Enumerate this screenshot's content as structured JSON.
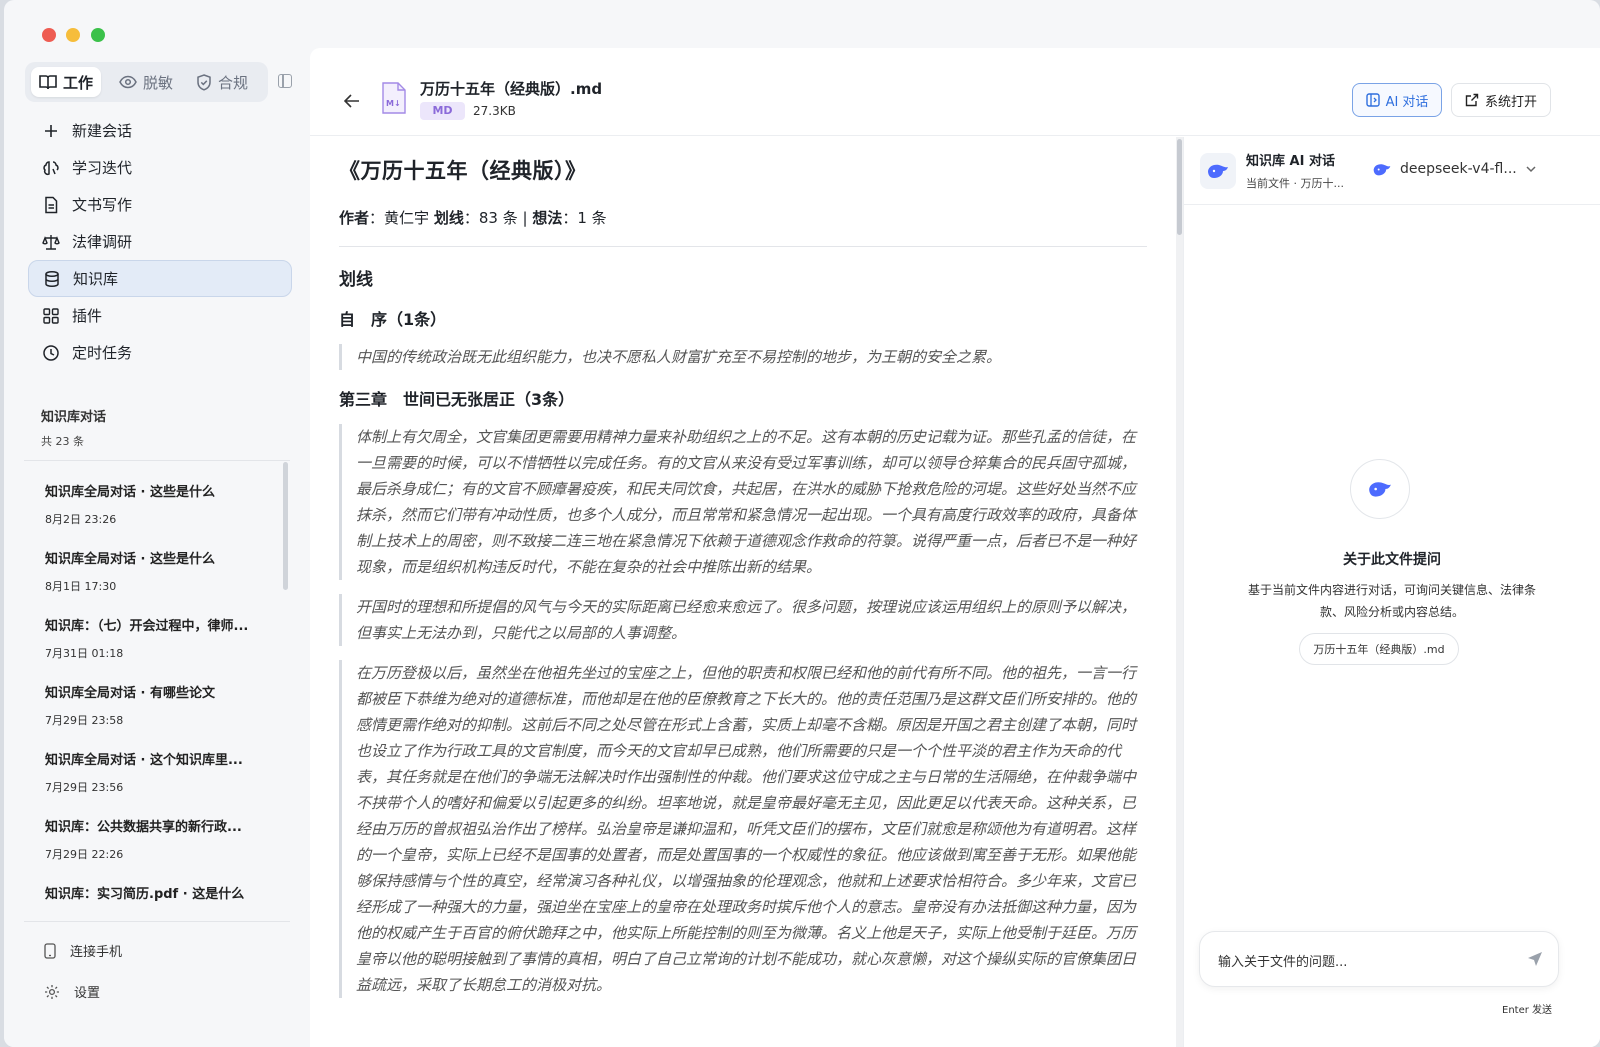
{
  "colors": {
    "accent": "#2f6fde",
    "active_nav": "#e3ebf7",
    "md_badge": "#8b6ad9",
    "close": "#ee5c52",
    "minimize": "#f6bd3b",
    "zoom": "#3bc14a"
  },
  "sidebar": {
    "segments": [
      {
        "label": "工作",
        "icon": "book-icon"
      },
      {
        "label": "脱敏",
        "icon": "eye-icon"
      },
      {
        "label": "合规",
        "icon": "shield-icon"
      }
    ],
    "nav": [
      {
        "label": "新建会话",
        "icon": "plus-icon"
      },
      {
        "label": "学习迭代",
        "icon": "brain-icon"
      },
      {
        "label": "文书写作",
        "icon": "document-icon"
      },
      {
        "label": "法律调研",
        "icon": "scale-icon"
      },
      {
        "label": "知识库",
        "icon": "database-icon"
      },
      {
        "label": "插件",
        "icon": "grid-icon"
      },
      {
        "label": "定时任务",
        "icon": "clock-icon"
      }
    ],
    "kb_title": "知识库对话",
    "kb_count": "共 23 条",
    "conversations": [
      {
        "title": "知识库全局对话 · 这些是什么",
        "date": "8月2日 23:26"
      },
      {
        "title": "知识库全局对话 · 这些是什么",
        "date": "8月1日 17:30"
      },
      {
        "title": "知识库：（七）开会过程中，律师...",
        "date": "7月31日 01:18"
      },
      {
        "title": "知识库全局对话 · 有哪些论文",
        "date": "7月29日 23:58"
      },
      {
        "title": "知识库全局对话 · 这个知识库里...",
        "date": "7月29日 23:56"
      },
      {
        "title": "知识库：公共数据共享的新行政...",
        "date": "7月29日 22:26"
      },
      {
        "title": "知识库：实习简历.pdf · 这是什么",
        "date": ""
      }
    ],
    "connect_phone": "连接手机",
    "settings": "设置"
  },
  "header": {
    "file_name": "万历十五年（经典版）.md",
    "badge": "MD",
    "size": "27.3KB",
    "ai_button": "AI 对话",
    "open_button": "系统打开"
  },
  "doc": {
    "title": "《万历十五年（经典版）》",
    "meta_author_label": "作者",
    "meta_author": "黄仁宇",
    "meta_hl_label": "划线",
    "meta_hl": "83 条",
    "meta_note_label": "想法",
    "meta_note": "1 条",
    "section": "划线",
    "ch1": "自　序（1条）",
    "q1": "中国的传统政治既无此组织能力，也决不愿私人财富扩充至不易控制的地步，为王朝的安全之累。",
    "ch2": "第三章　世间已无张居正（3条）",
    "q2": "体制上有欠周全，文官集团更需要用精神力量来补助组织之上的不足。这有本朝的历史记载为证。那些孔孟的信徒，在一旦需要的时候，可以不惜牺牲以完成任务。有的文官从来没有受过军事训练，却可以领导仓猝集合的民兵固守孤城，最后杀身成仁；有的文官不顾瘴暑疫疾，和民夫同饮食，共起居，在洪水的威胁下抢救危险的河堤。这些好处当然不应抹杀，然而它们带有冲动性质，也多个人成分，而且常常和紧急情况一起出现。一个具有高度行政效率的政府，具备体制上技术上的周密，则不致接二连三地在紧急情况下依赖于道德观念作救命的符箓。说得严重一点，后者已不是一种好现象，而是组织机构违反时代，不能在复杂的社会中推陈出新的结果。",
    "q3": "开国时的理想和所提倡的风气与今天的实际距离已经愈来愈远了。很多问题，按理说应该运用组织上的原则予以解决，但事实上无法办到，只能代之以局部的人事调整。",
    "q4": "在万历登极以后，虽然坐在他祖先坐过的宝座之上，但他的职责和权限已经和他的前代有所不同。他的祖先，一言一行都被臣下恭维为绝对的道德标准，而他却是在他的臣僚教育之下长大的。他的责任范围乃是这群文臣们所安排的。他的感情更需作绝对的抑制。这前后不同之处尽管在形式上含蓄，实质上却毫不含糊。原因是开国之君主创建了本朝，同时也设立了作为行政工具的文官制度，而今天的文官却早已成熟，他们所需要的只是一个个性平淡的君主作为天命的代表，其任务就是在他们的争端无法解决时作出强制性的仲裁。他们要求这位守成之主与日常的生活隔绝，在仲裁争端中不挟带个人的嗜好和偏爱以引起更多的纠纷。坦率地说，就是皇帝最好毫无主见，因此更足以代表天命。这种关系，已经由万历的曾叔祖弘治作出了榜样。弘治皇帝是谦抑温和，听凭文臣们的摆布，文臣们就愈是称颂他为有道明君。这样的一个皇帝，实际上已经不是国事的处置者，而是处置国事的一个权威性的象征。他应该做到寓至善于无形。如果他能够保持感情与个性的真空，经常演习各种礼仪，以增强抽象的伦理观念，他就和上述要求恰相符合。多少年来，文官已经形成了一种强大的力量，强迫坐在宝座上的皇帝在处理政务时摈斥他个人的意志。皇帝没有办法抵御这种力量，因为他的权威产生于百官的俯伏跪拜之中，他实际上所能控制的则至为微薄。名义上他是天子，实际上他受制于廷臣。万历皇帝以他的聪明接触到了事情的真相，明白了自己立常询的计划不能成功，就心灰意懒，对这个操纵实际的官僚集团日益疏远，采取了长期怠工的消极对抗。"
  },
  "chat": {
    "title": "知识库 AI 对话",
    "subtitle": "当前文件 · 万历十...",
    "model": "deepseek-v4-fl...",
    "empty_title": "关于此文件提问",
    "empty_desc_1": "基于当前文件内容进行对话，可询问关键信息、法律条",
    "empty_desc_2": "款、风险分析或内容总结。",
    "file_chip": "万历十五年（经典版）.md",
    "input_placeholder": "输入关于文件的问题...",
    "enter_hint": "Enter 发送"
  }
}
